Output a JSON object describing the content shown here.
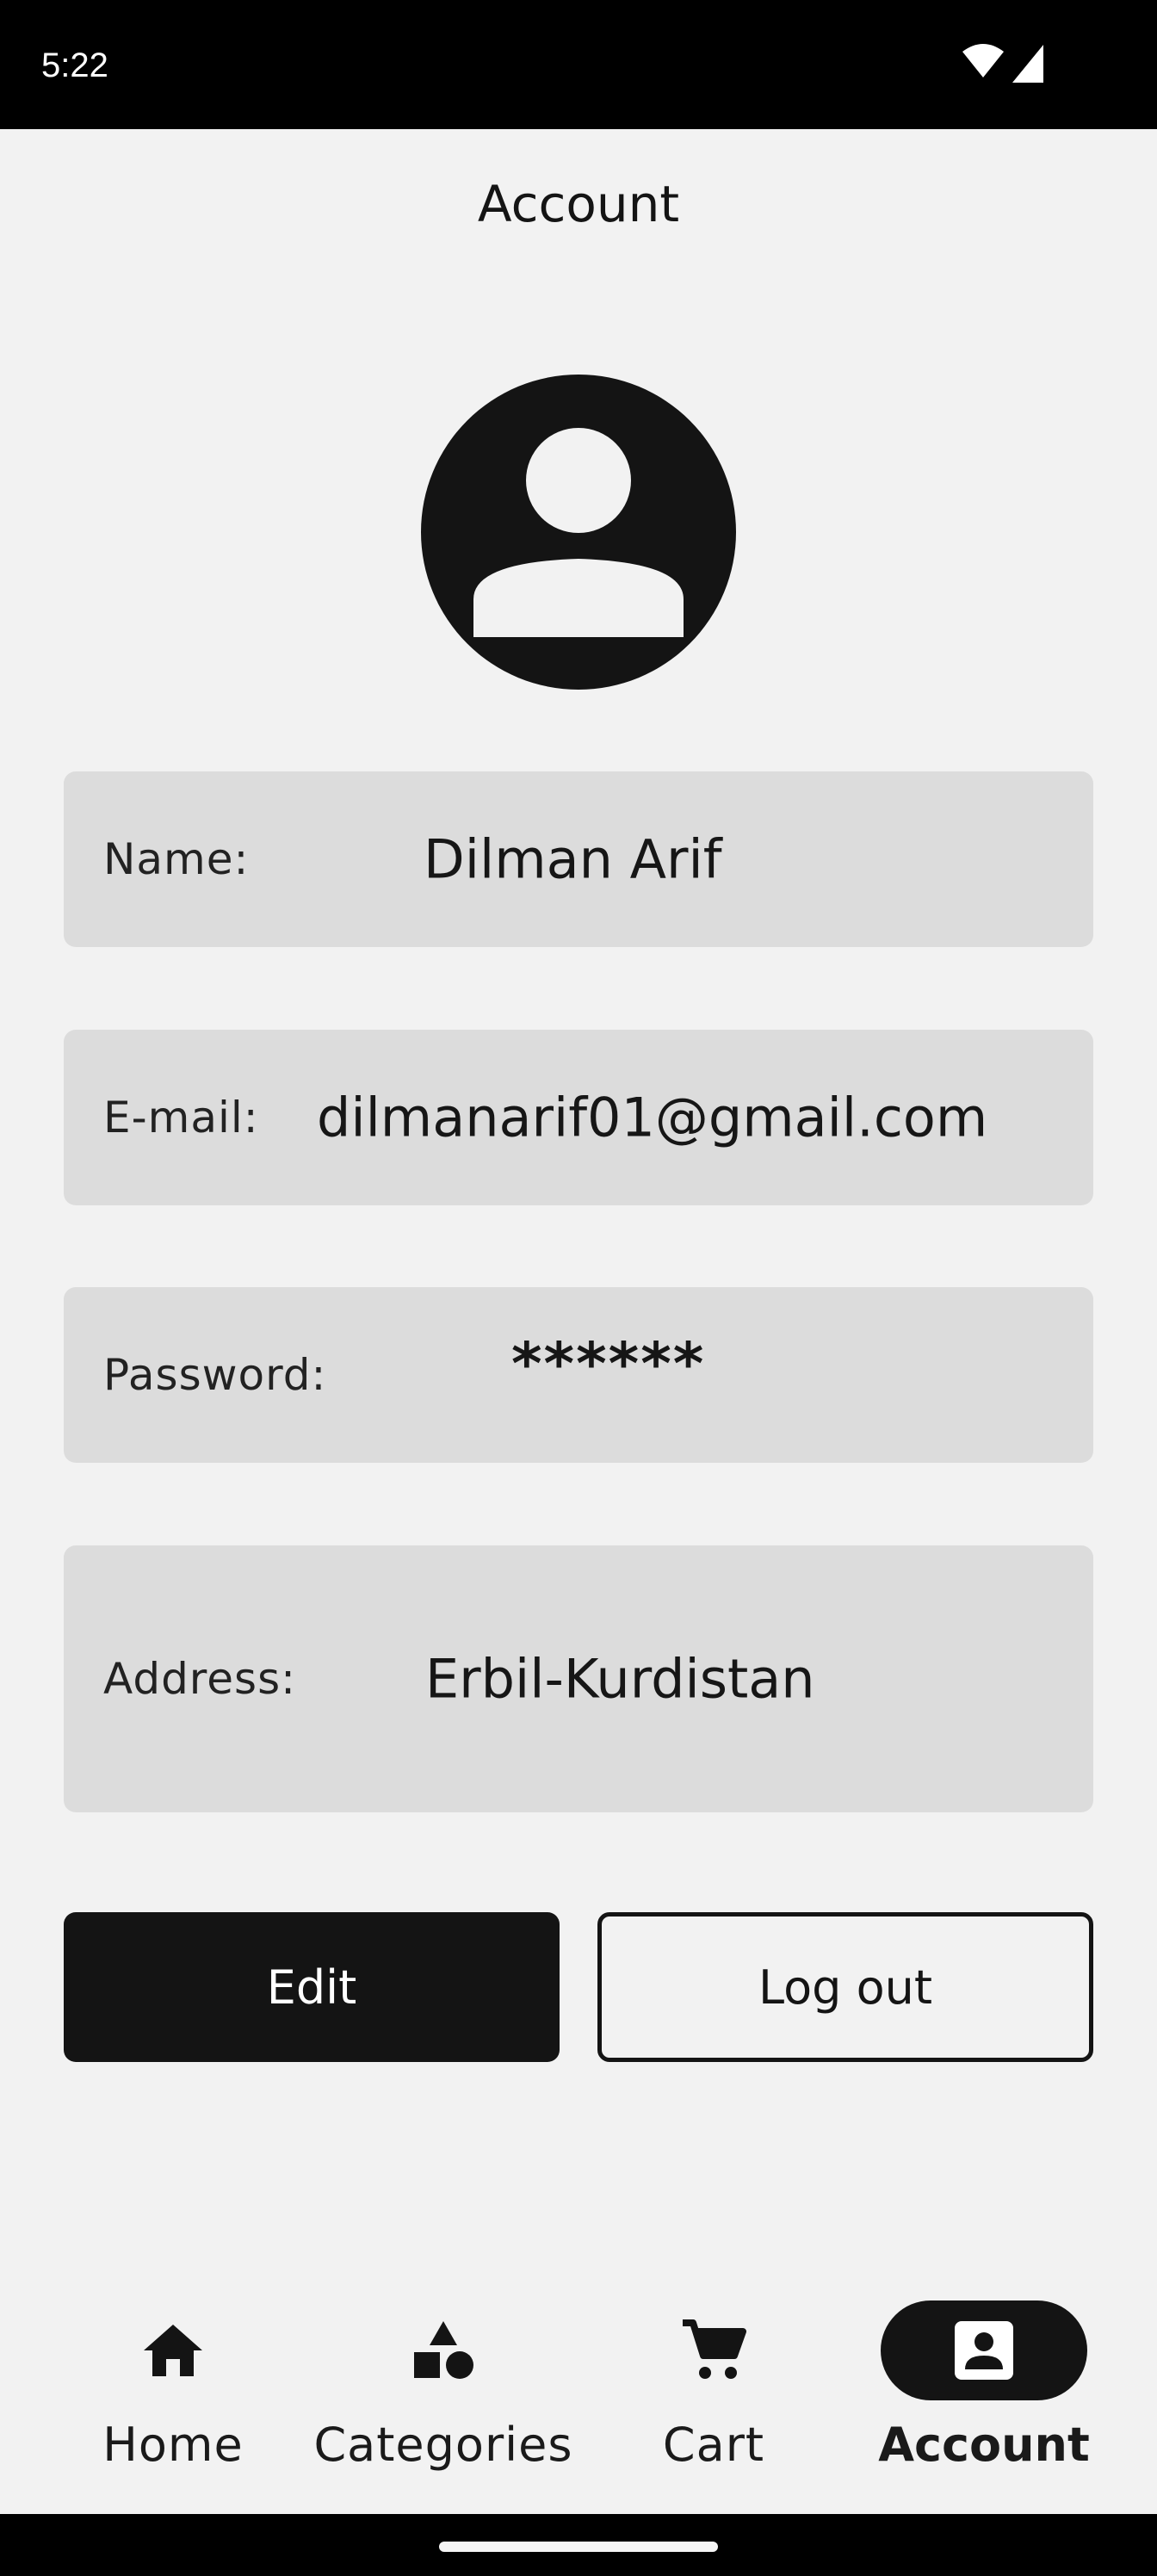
{
  "status_bar": {
    "time": "5:22",
    "icons": [
      "wifi-icon",
      "cell-signal-icon"
    ]
  },
  "app_bar": {
    "title": "Account"
  },
  "profile": {
    "avatar_icon": "account-circle-icon",
    "fields": {
      "name": {
        "label": "Name:",
        "value": "Dilman Arif"
      },
      "email": {
        "label": "E-mail:",
        "value": "dilmanarif01@gmail.com"
      },
      "password": {
        "label": "Password:",
        "value": "******"
      },
      "address": {
        "label": "Address:",
        "value": "Erbil-Kurdistan"
      }
    }
  },
  "actions": {
    "edit_label": "Edit",
    "logout_label": "Log out"
  },
  "bottom_nav": {
    "items": [
      {
        "label": "Home",
        "icon": "home-icon",
        "active": false
      },
      {
        "label": "Categories",
        "icon": "category-icon",
        "active": false
      },
      {
        "label": "Cart",
        "icon": "cart-icon",
        "active": false
      },
      {
        "label": "Account",
        "icon": "account-box-icon",
        "active": true
      }
    ]
  },
  "colors": {
    "background": "#f2f2f2",
    "card": "#dcdcdc",
    "primary": "#141414",
    "on_primary": "#ffffff"
  }
}
